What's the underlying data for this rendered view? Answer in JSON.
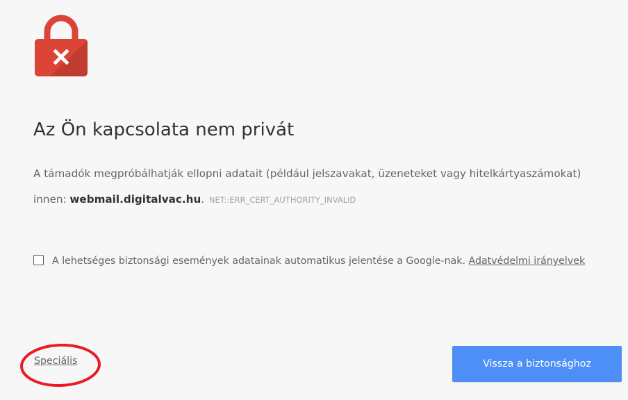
{
  "colors": {
    "background": "#f7f7f7",
    "lock_red": "#db4437",
    "button_blue": "#4e8ff7",
    "annotation_red": "#e81c24"
  },
  "icons": {
    "header": "lock-icon with x mark"
  },
  "title": "Az Ön kapcsolata nem privát",
  "message": {
    "before_host": "A támadók megpróbálhatják ellopni adatait (például jelszavakat, üzeneteket vagy hitelkártyaszámokat) innen: ",
    "host": "webmail.digitalvac.hu",
    "after_host": ".",
    "error_code": "NET::ERR_CERT_AUTHORITY_INVALID"
  },
  "report": {
    "checked": false,
    "label": "A lehetséges biztonsági események adatainak automatikus jelentése a Google-nak.",
    "privacy_link": "Adatvédelmi irányelvek"
  },
  "advanced_link": "Speciális",
  "back_button": "Vissza a biztonsághoz"
}
